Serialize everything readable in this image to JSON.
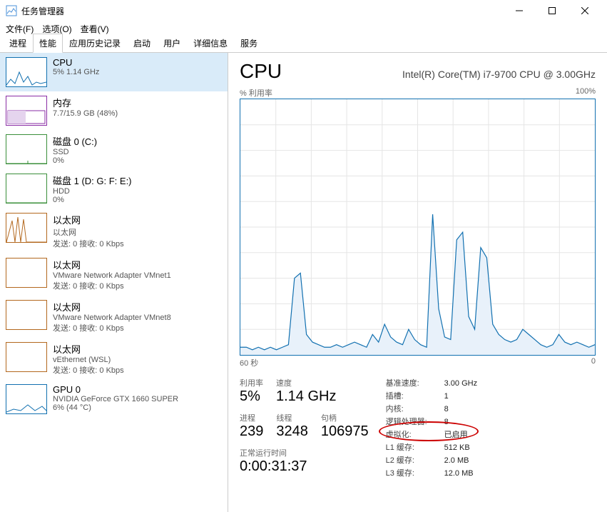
{
  "window": {
    "title": "任务管理器"
  },
  "menu": {
    "file": "文件(F)",
    "options": "选项(O)",
    "view": "查看(V)"
  },
  "tabs": [
    "进程",
    "性能",
    "应用历史记录",
    "启动",
    "用户",
    "详细信息",
    "服务"
  ],
  "sidebar": [
    {
      "name": "CPU",
      "sub1": "5% 1.14 GHz",
      "sub2": "",
      "color": "#1170b0"
    },
    {
      "name": "内存",
      "sub1": "7.7/15.9 GB (48%)",
      "sub2": "",
      "color": "#8a2da5"
    },
    {
      "name": "磁盘 0 (C:)",
      "sub1": "SSD",
      "sub2": "0%",
      "color": "#3a8f3a"
    },
    {
      "name": "磁盘 1 (D: G: F: E:)",
      "sub1": "HDD",
      "sub2": "0%",
      "color": "#3a8f3a"
    },
    {
      "name": "以太网",
      "sub1": "以太网",
      "sub2": "发送: 0 接收: 0 Kbps",
      "color": "#b3681e"
    },
    {
      "name": "以太网",
      "sub1": "VMware Network Adapter VMnet1",
      "sub2": "发送: 0 接收: 0 Kbps",
      "color": "#b3681e"
    },
    {
      "name": "以太网",
      "sub1": "VMware Network Adapter VMnet8",
      "sub2": "发送: 0 接收: 0 Kbps",
      "color": "#b3681e"
    },
    {
      "name": "以太网",
      "sub1": "vEthernet (WSL)",
      "sub2": "发送: 0 接收: 0 Kbps",
      "color": "#b3681e"
    },
    {
      "name": "GPU 0",
      "sub1": "NVIDIA GeForce GTX 1660 SUPER",
      "sub2": "6% (44 °C)",
      "color": "#1170b0"
    }
  ],
  "main": {
    "title": "CPU",
    "model": "Intel(R) Core(TM) i7-9700 CPU @ 3.00GHz",
    "chart_top_left": "% 利用率",
    "chart_top_right": "100%",
    "chart_bottom_left": "60 秒",
    "chart_bottom_right": "0",
    "stats": {
      "util_label": "利用率",
      "util_value": "5%",
      "speed_label": "速度",
      "speed_value": "1.14 GHz",
      "proc_label": "进程",
      "proc_value": "239",
      "thread_label": "线程",
      "thread_value": "3248",
      "handle_label": "句柄",
      "handle_value": "106975",
      "uptime_label": "正常运行时间",
      "uptime_value": "0:00:31:37"
    },
    "kv": {
      "base_speed_k": "基准速度:",
      "base_speed_v": "3.00 GHz",
      "sockets_k": "插槽:",
      "sockets_v": "1",
      "cores_k": "内核:",
      "cores_v": "8",
      "lproc_k": "逻辑处理器:",
      "lproc_v": "8",
      "virt_k": "虚拟化:",
      "virt_v": "已启用",
      "l1_k": "L1 缓存:",
      "l1_v": "512 KB",
      "l2_k": "L2 缓存:",
      "l2_v": "2.0 MB",
      "l3_k": "L3 缓存:",
      "l3_v": "12.0 MB"
    }
  },
  "chart_data": {
    "type": "line",
    "title": "CPU 利用率",
    "xlabel": "60 秒 → 0",
    "ylabel": "% 利用率",
    "ylim": [
      0,
      100
    ],
    "x_range_seconds": [
      60,
      0
    ],
    "series": [
      {
        "name": "利用率",
        "values": [
          3,
          3,
          2,
          3,
          2,
          3,
          2,
          3,
          4,
          30,
          32,
          8,
          5,
          4,
          3,
          3,
          4,
          3,
          4,
          5,
          4,
          3,
          8,
          5,
          12,
          7,
          5,
          4,
          10,
          6,
          4,
          3,
          55,
          18,
          7,
          6,
          45,
          48,
          15,
          10,
          42,
          38,
          12,
          8,
          6,
          5,
          6,
          10,
          8,
          6,
          4,
          3,
          4,
          8,
          5,
          4,
          5,
          4,
          3,
          4
        ]
      }
    ]
  }
}
